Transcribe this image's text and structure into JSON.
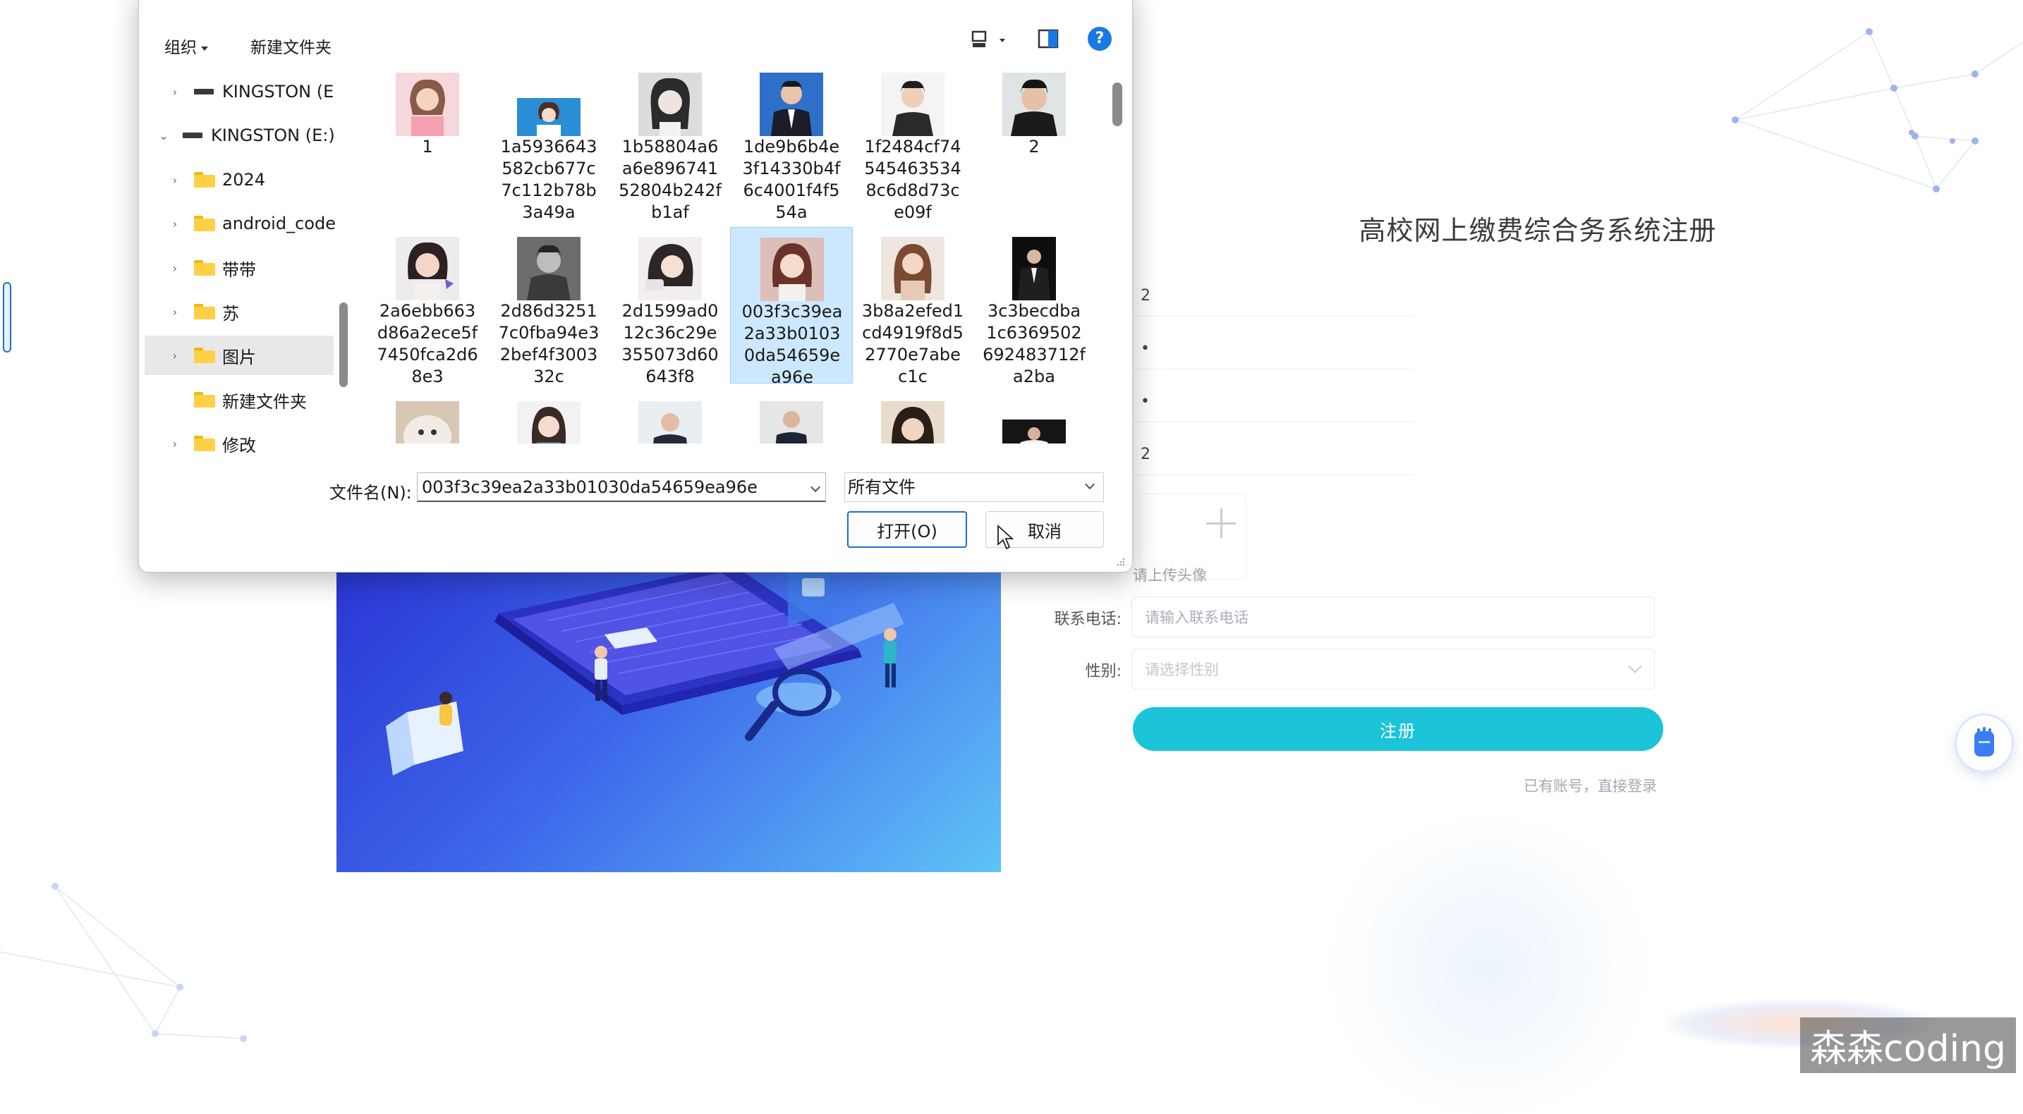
{
  "dialog": {
    "toolbar": {
      "organize_label": "组织",
      "new_folder_label": "新建文件夹"
    },
    "nav_items": [
      {
        "label": "KINGSTON (E",
        "type": "drive",
        "expanded": false
      },
      {
        "label": "KINGSTON (E:)",
        "type": "drive",
        "expanded": true
      },
      {
        "label": "2024",
        "type": "folder"
      },
      {
        "label": "android_code",
        "type": "folder"
      },
      {
        "label": "带带",
        "type": "folder"
      },
      {
        "label": "苏",
        "type": "folder"
      },
      {
        "label": "图片",
        "type": "folder",
        "selected": true
      },
      {
        "label": "新建文件夹",
        "type": "folder",
        "no_chevron": true
      },
      {
        "label": "修改",
        "type": "folder"
      }
    ],
    "files": [
      {
        "name": "1"
      },
      {
        "name": "1a5936643582cb677c7c112b78b3a49a"
      },
      {
        "name": "1b58804a6a6e89674152804b242fb1af"
      },
      {
        "name": "1de9b6b4e3f14330b4f6c4001f4f554a"
      },
      {
        "name": "1f2484cf745454635348c6d8d73ce09f"
      },
      {
        "name": "2"
      },
      {
        "name": "2a6ebb663d86a2ece5f7450fca2d68e3"
      },
      {
        "name": "2d86d32517c0fba94e32bef4f300332c"
      },
      {
        "name": "2d1599ad012c36c29e355073d60643f8"
      },
      {
        "name": "003f3c39ea2a33b01030da54659ea96e",
        "selected": true
      },
      {
        "name": "3b8a2efed1cd4919f8d52770e7abec1c"
      },
      {
        "name": "3c3becdba1c6369502692483712fa2ba"
      },
      {
        "name": ""
      },
      {
        "name": ""
      },
      {
        "name": ""
      },
      {
        "name": ""
      },
      {
        "name": ""
      },
      {
        "name": ""
      }
    ],
    "filename_label": "文件名(N):",
    "filename_value": "003f3c39ea2a33b01030da54659ea96e",
    "filter_value": "所有文件",
    "open_label": "打开(O)",
    "cancel_label": "取消"
  },
  "page": {
    "title": "高校网上缴费综合务系统注册",
    "filled_values": [
      "2",
      "•",
      "•",
      "2"
    ],
    "upload_hint": "请上传头像",
    "phone_label": "联系电话:",
    "phone_placeholder": "请输入联系电话",
    "gender_label": "性别:",
    "gender_placeholder": "请选择性别",
    "register_label": "注册",
    "login_link": "已有账号，直接登录"
  },
  "watermark": "森森coding",
  "colors": {
    "accent": "#1bc4d8",
    "dialog_selection": "#cce8ff",
    "help_blue": "#1a78e4"
  }
}
